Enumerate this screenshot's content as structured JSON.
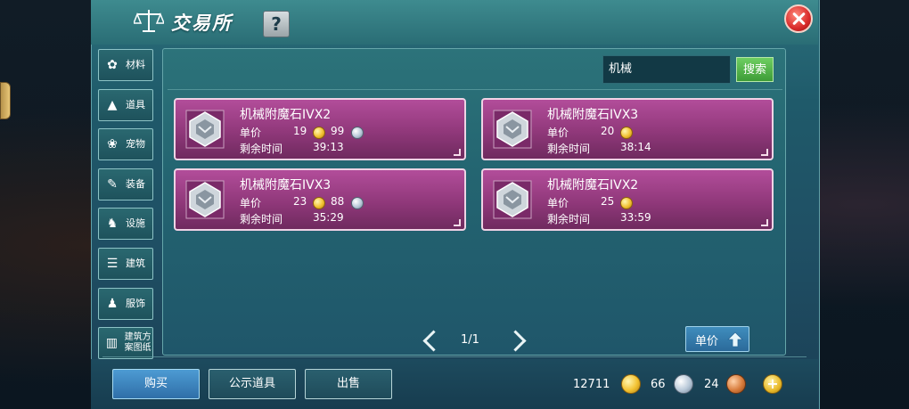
{
  "window": {
    "title": "交易所",
    "help_label": "?"
  },
  "categories": [
    {
      "label": "材料",
      "icon": "materials-icon"
    },
    {
      "label": "道具",
      "icon": "tools-icon"
    },
    {
      "label": "宠物",
      "icon": "pet-paw-icon"
    },
    {
      "label": "装备",
      "icon": "equipment-icon"
    },
    {
      "label": "设施",
      "icon": "facility-icon"
    },
    {
      "label": "建筑",
      "icon": "building-icon"
    },
    {
      "label": "服饰",
      "icon": "clothing-icon"
    },
    {
      "label": "建筑方案图纸",
      "icon": "blueprint-icon"
    }
  ],
  "search": {
    "value": "机械",
    "button_label": "搜索"
  },
  "listings": [
    {
      "name": "机械附魔石IVX2",
      "price_label": "单价",
      "price_gold": "19",
      "price_silver": "99",
      "time_label": "剩余时间",
      "time": "39:13"
    },
    {
      "name": "机械附魔石IVX3",
      "price_label": "单价",
      "price_gold": "20",
      "price_silver": "",
      "time_label": "剩余时间",
      "time": "38:14"
    },
    {
      "name": "机械附魔石IVX3",
      "price_label": "单价",
      "price_gold": "23",
      "price_silver": "88",
      "time_label": "剩余时间",
      "time": "35:29"
    },
    {
      "name": "机械附魔石IVX2",
      "price_label": "单价",
      "price_gold": "25",
      "price_silver": "",
      "time_label": "剩余时间",
      "time": "33:59"
    }
  ],
  "pager": {
    "text": "1/1"
  },
  "sort": {
    "label": "单价"
  },
  "bottom_tabs": {
    "buy": "购买",
    "public": "公示道具",
    "sell": "出售"
  },
  "currency": {
    "gold": "12711",
    "silver": "66",
    "bronze": "24",
    "add_label": "+"
  },
  "colors": {
    "card": "#a0408a",
    "active_tab": "#3f86c4",
    "search_button": "#4fae45",
    "close": "#d92a2a"
  }
}
